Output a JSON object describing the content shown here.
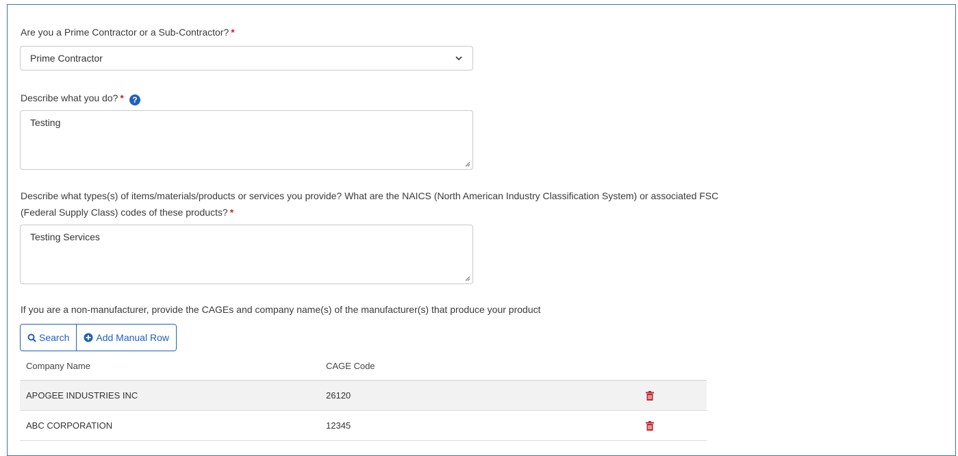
{
  "q1": {
    "label": "Are you a Prime Contractor or a Sub-Contractor?",
    "required": "*",
    "selected": "Prime Contractor"
  },
  "q2": {
    "label": "Describe what you do?",
    "required": "*",
    "help": "?",
    "value": "Testing"
  },
  "q3": {
    "label_line1": "Describe what types(s) of items/materials/products or services you provide? What are the NAICS (North American Industry Classification System) or associated FSC",
    "label_line2": "(Federal Supply Class) codes of these products?",
    "required": "*",
    "value": "Testing Services"
  },
  "q4": {
    "label": "If you are a non-manufacturer, provide the CAGEs and company name(s) of the manufacturer(s) that produce your product"
  },
  "buttons": {
    "search_label": "Search",
    "add_row_label": "Add Manual Row"
  },
  "table": {
    "headers": [
      "Company Name",
      "CAGE Code"
    ],
    "rows": [
      {
        "company": "APOGEE INDUSTRIES INC",
        "cage": "26120"
      },
      {
        "company": "ABC CORPORATION",
        "cage": "12345"
      }
    ]
  },
  "colors": {
    "accent": "#1f5fbf",
    "required": "#c0272d",
    "delete": "#c0272d",
    "frame_border": "#3f6fb5"
  }
}
